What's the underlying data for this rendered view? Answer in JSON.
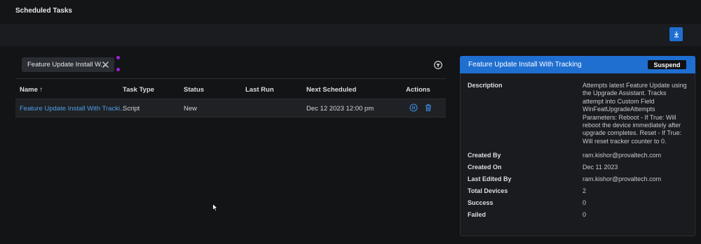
{
  "page": {
    "title": "Scheduled Tasks"
  },
  "toolbar": {
    "download_icon": "download-icon",
    "accent": "#1f6fd1"
  },
  "filter": {
    "chip_label": "Feature Update Install W...",
    "close_icon": "close-icon",
    "filter_toggle_icon": "filter-icon"
  },
  "table": {
    "columns": [
      "Name ↑",
      "Task Type",
      "Status",
      "Last Run",
      "Next Scheduled",
      "Actions"
    ],
    "rows": [
      {
        "name": "Feature Update Install With Tracki...",
        "task_type": "Script",
        "status": "New",
        "last_run": "",
        "next_scheduled": "Dec 12 2023 12:00 pm",
        "actions": [
          "pause-icon",
          "trash-icon"
        ]
      }
    ]
  },
  "details": {
    "title": "Feature Update Install With Tracking",
    "suspend_label": "Suspend",
    "fields": [
      {
        "label": "Description",
        "value": "Attempts latest Feature Update using the Upgrade Assistant. Tracks attempt into Custom Field WinFeatUpgradeAttempts Parameters: Reboot - If True: Will reboot the device immediately after upgrade completes. Reset - If True: Will reset tracker counter to 0."
      },
      {
        "label": "Created By",
        "value": "ram.kishor@provaltech.com"
      },
      {
        "label": "Created On",
        "value": "Dec 11 2023"
      },
      {
        "label": "Last Edited By",
        "value": "ram.kishor@provaltech.com"
      },
      {
        "label": "Total Devices",
        "value": "2"
      },
      {
        "label": "Success",
        "value": "0"
      },
      {
        "label": "Failed",
        "value": "0"
      }
    ]
  }
}
